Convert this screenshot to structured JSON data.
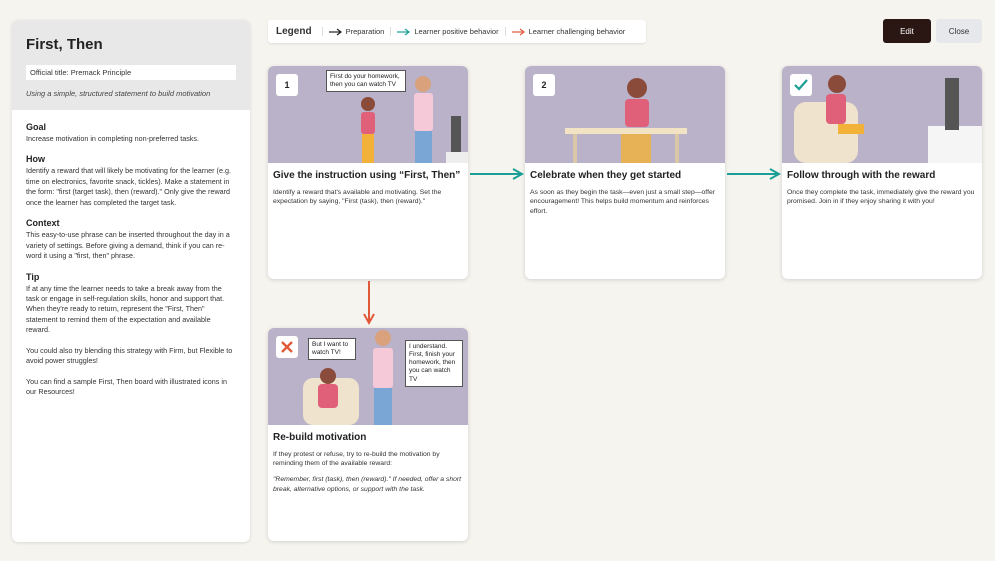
{
  "left": {
    "title": "First, Then",
    "official": "Official title: Premack Principle",
    "subtitle": "Using a simple, structured statement to build motivation",
    "goal_h": "Goal",
    "goal_p": "Increase motivation in completing non-preferred tasks.",
    "how_h": "How",
    "how_p": "Identify a reward that will likely be motivating for the learner (e.g. time on electronics, favorite snack, tickles). Make a statement in the form: \"first (target task), then (reward).\" Only give the reward once the learner has completed the target task.",
    "context_h": "Context",
    "context_p": "This easy-to-use phrase can be inserted throughout the day in a variety of settings. Before giving a demand, think if you can re-word it using a \"first, then\" phrase.",
    "tip_h": "Tip",
    "tip_p1": "If at any time the learner needs to take a break away from the task or engage in self-regulation skills, honor and support that. When they're ready to return, represent the \"First, Then\" statement to remind them of the expectation and available reward.",
    "tip_p2": "You could also try blending this strategy with Firm, but Flexible to avoid power struggles!",
    "tip_p3": "You can find a sample First, Then board with illustrated icons in our Resources!"
  },
  "legend": {
    "title": "Legend",
    "items": [
      "Preparation",
      "Learner positive behavior",
      "Learner challenging behavior"
    ]
  },
  "buttons": {
    "edit": "Edit",
    "close": "Close"
  },
  "cards": {
    "c1": {
      "badge": "1",
      "bubble": "First do your homework, then you can watch TV",
      "title": "Give the instruction using “First, Then”",
      "text": "Identify a reward that's available and motivating. Set the expectation by saying, \"First (task), then (reward).\""
    },
    "c2": {
      "badge": "2",
      "title": "Celebrate when they get started",
      "text": "As soon as they begin the task—even just a small step—offer encouragement! This helps build momentum and reinforces effort."
    },
    "c3": {
      "title": "Follow through with the reward",
      "text": "Once they complete the task, immediately give the reward you promised. Join in if they enjoy sharing it with you!"
    },
    "c4": {
      "bubble1": "But I want to watch TV!",
      "bubble2": "I understand. First, finish your homework, then you can watch TV",
      "title": "Re-build motivation",
      "text": "If they protest or refuse, try to re-build the motivation by reminding them of the available reward:",
      "text_it": "\"Remember, first (task), then (reward).\" If needed, offer a short break, alternative options, or support with the task."
    }
  },
  "colors": {
    "preparation": "#222222",
    "positive": "#1a9e95",
    "challenging": "#e05a3a",
    "scene_bg": "#b9b2c8"
  }
}
